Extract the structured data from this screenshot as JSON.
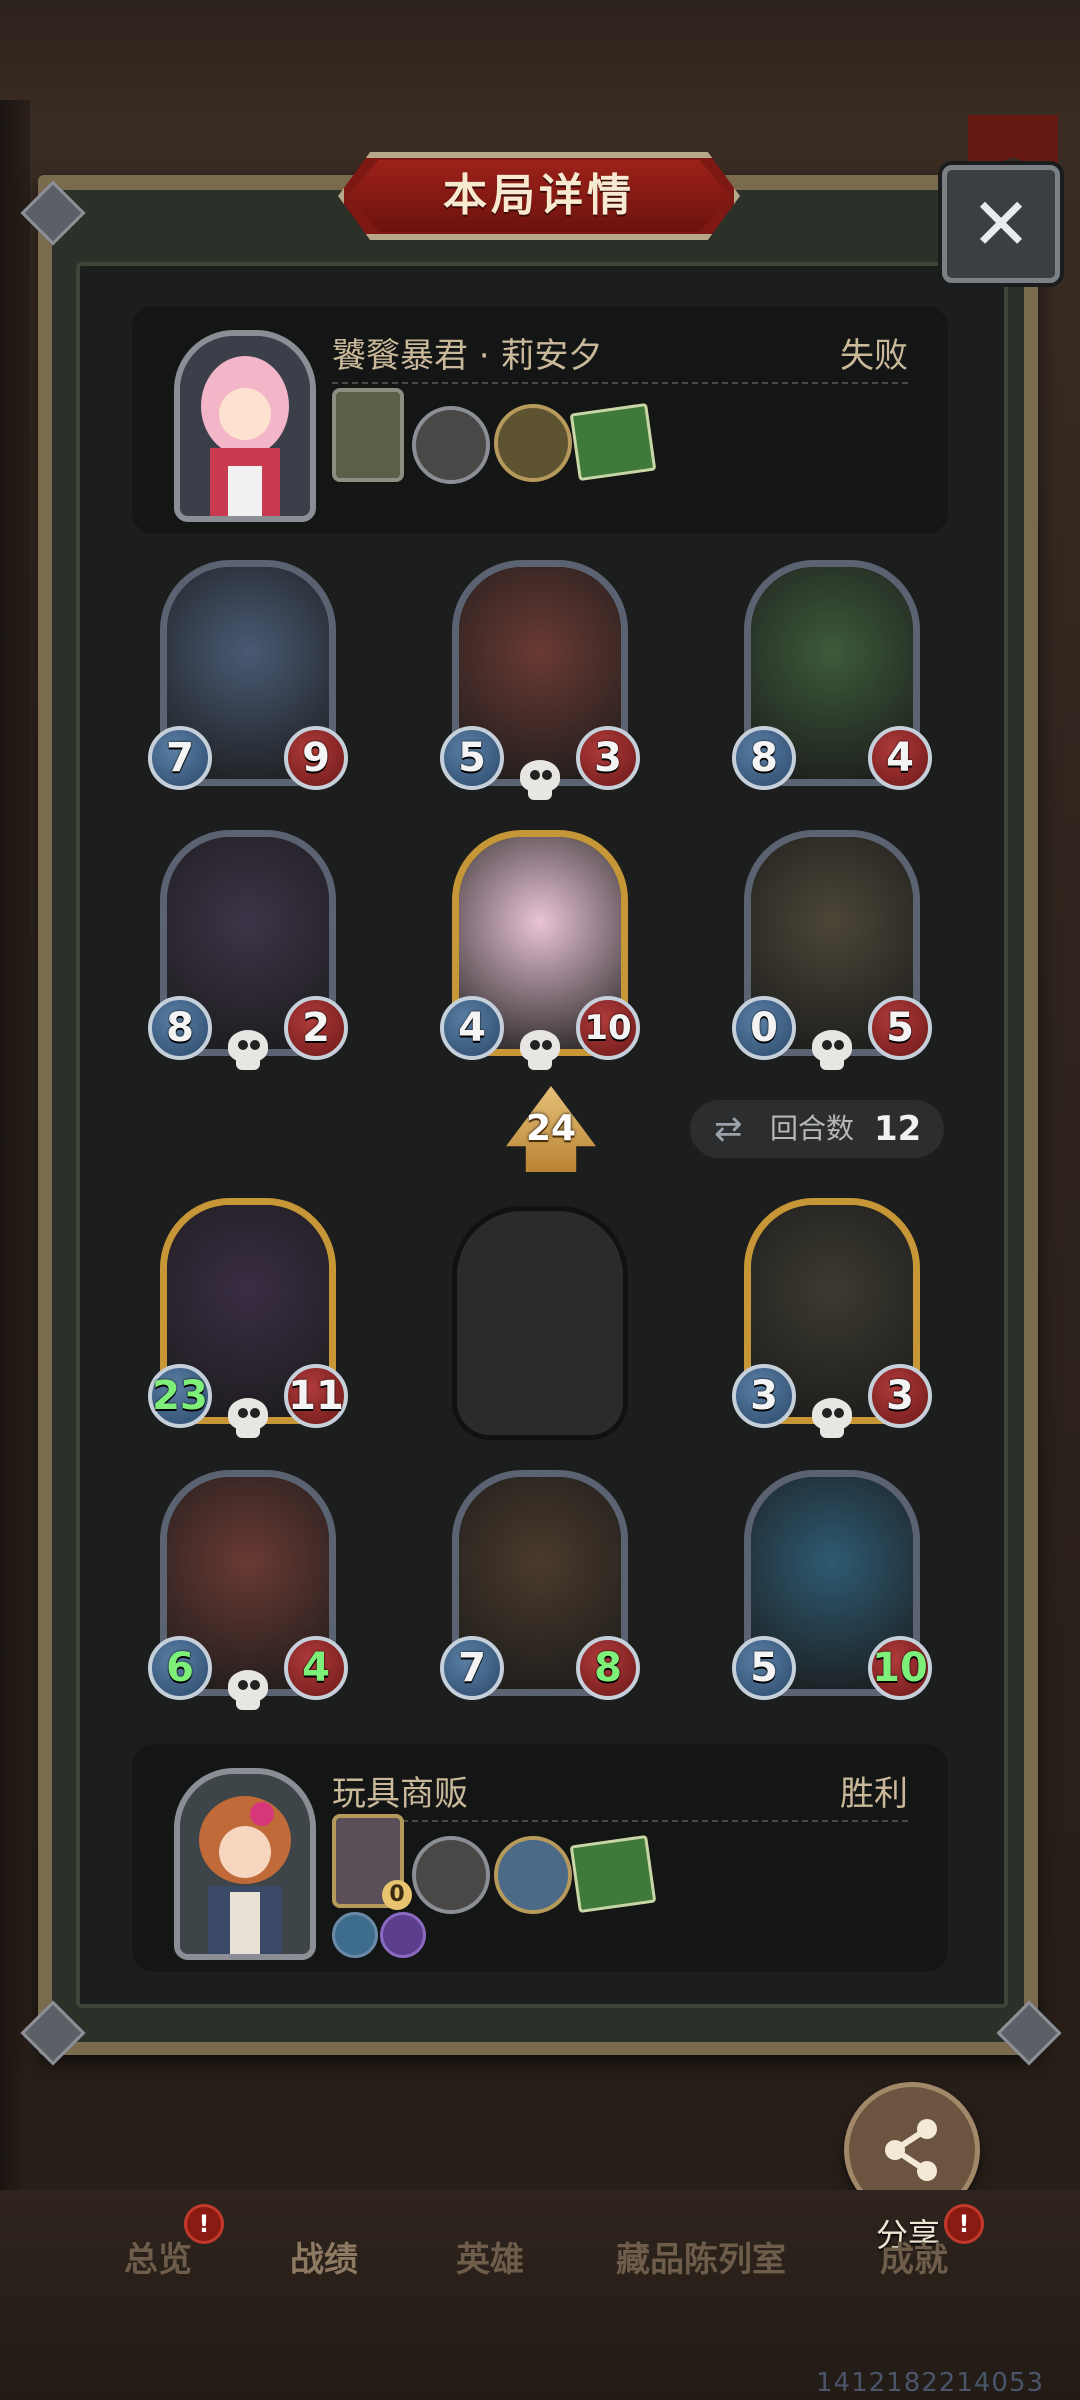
{
  "dialog": {
    "title": "本局详情",
    "close_label": "✕"
  },
  "player_top": {
    "name": "饕餮暴君 · 莉安夕",
    "result": "失败"
  },
  "player_bottom": {
    "name": "玩具商贩",
    "result": "胜利",
    "item_count": "0"
  },
  "level_badge": "24",
  "turns": {
    "label": "回合数",
    "value": "12"
  },
  "board_top": [
    {
      "atk": "7",
      "hp": "9",
      "skull": false
    },
    {
      "atk": "5",
      "hp": "3",
      "skull": true
    },
    {
      "atk": "8",
      "hp": "4",
      "skull": false
    }
  ],
  "board_top_row2": [
    {
      "atk": "8",
      "hp": "2",
      "skull": true
    },
    {
      "atk": "4",
      "hp": "10",
      "skull": true,
      "hero": true
    },
    {
      "atk": "0",
      "hp": "5",
      "skull": true
    }
  ],
  "board_bottom": [
    {
      "atk": "23",
      "hp": "11",
      "skull": true
    },
    {
      "atk": "3",
      "hp": "3",
      "skull": true
    }
  ],
  "board_bottom_row2": [
    {
      "atk": "6",
      "hp": "4",
      "skull": true
    },
    {
      "atk": "7",
      "hp": "8",
      "skull": false
    },
    {
      "atk": "5",
      "hp": "10",
      "skull": false
    }
  ],
  "share": {
    "label": "分享"
  },
  "tabs": [
    {
      "label": "总览",
      "badge": "!"
    },
    {
      "label": "战绩"
    },
    {
      "label": "英雄"
    },
    {
      "label": "藏品陈列室"
    },
    {
      "label": "成就",
      "badge": "!"
    }
  ],
  "uid": "1412182214053"
}
